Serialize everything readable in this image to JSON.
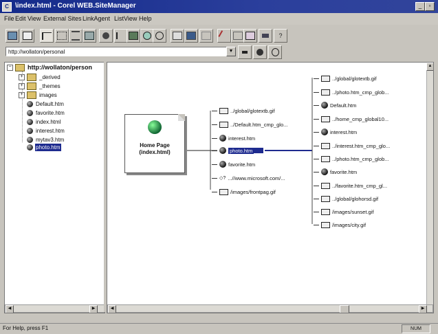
{
  "window": {
    "title": "\\index.html - Corel WEB.SiteManager",
    "app_icon": "C"
  },
  "menu": [
    "File",
    "Edit",
    "View",
    "External Sites",
    "LinkAgent",
    "ListView",
    "Help"
  ],
  "address": {
    "value": "http://wollaton/personal"
  },
  "toolbar_icons": [
    "save-icon",
    "home-icon",
    "link-view-icon",
    "grid-view-icon",
    "list-view-icon",
    "tree-view-icon",
    "circle-icon",
    "arrow-icon",
    "image-icon",
    "globe-icon",
    "question-icon",
    "print-icon",
    "properties-icon",
    "refresh-icon",
    "stop-icon",
    "open-icon",
    "copy-icon",
    "paste-icon",
    "help-icon"
  ],
  "tree": {
    "root": "http://wollaton/person",
    "items": [
      {
        "label": "_derived",
        "type": "folder"
      },
      {
        "label": "_themes",
        "type": "folder"
      },
      {
        "label": "images",
        "type": "folder"
      },
      {
        "label": "Default.htm",
        "type": "page"
      },
      {
        "label": "favorite.htm",
        "type": "page"
      },
      {
        "label": "index.html",
        "type": "page"
      },
      {
        "label": "interest.htm",
        "type": "page"
      },
      {
        "label": "mytav3.htm",
        "type": "page"
      },
      {
        "label": "photo.htm",
        "type": "page",
        "selected": true
      }
    ]
  },
  "home_card": {
    "line1": "Home Page",
    "line2": "(index.html)"
  },
  "links_middle": [
    {
      "label": "../global/glotextb.gif",
      "icon": "page"
    },
    {
      "label": "../Default.htm_cmp_glo...",
      "icon": "page"
    },
    {
      "label": "interest.htm",
      "icon": "ball"
    },
    {
      "label": "photo.htm",
      "icon": "ball",
      "selected": true
    },
    {
      "label": "favorite.htm",
      "icon": "ball"
    },
    {
      "label": "...//www.microsoft.com/...",
      "icon": "external"
    },
    {
      "label": "/images/frontpag.gif",
      "icon": "page"
    }
  ],
  "links_right": [
    {
      "label": "../global/glotextb.gif",
      "icon": "page"
    },
    {
      "label": "../photo.htm_cmp_glob...",
      "icon": "page"
    },
    {
      "label": "Default.htm",
      "icon": "ball"
    },
    {
      "label": "../home_cmp_global10...",
      "icon": "page"
    },
    {
      "label": "interest.htm",
      "icon": "ball"
    },
    {
      "label": "../interest.htm_cmp_glo...",
      "icon": "page"
    },
    {
      "label": "../photo.htm_cmp_glob...",
      "icon": "page"
    },
    {
      "label": "favorite.htm",
      "icon": "ball"
    },
    {
      "label": "../favorite.htm_cmp_gl...",
      "icon": "page"
    },
    {
      "label": "../global/glohorsd.gif",
      "icon": "page"
    },
    {
      "label": "/images/sunset.gif",
      "icon": "page"
    },
    {
      "label": "/images/city.gif",
      "icon": "page"
    }
  ],
  "status": {
    "text": "For Help, press F1",
    "mode": "NUM"
  }
}
